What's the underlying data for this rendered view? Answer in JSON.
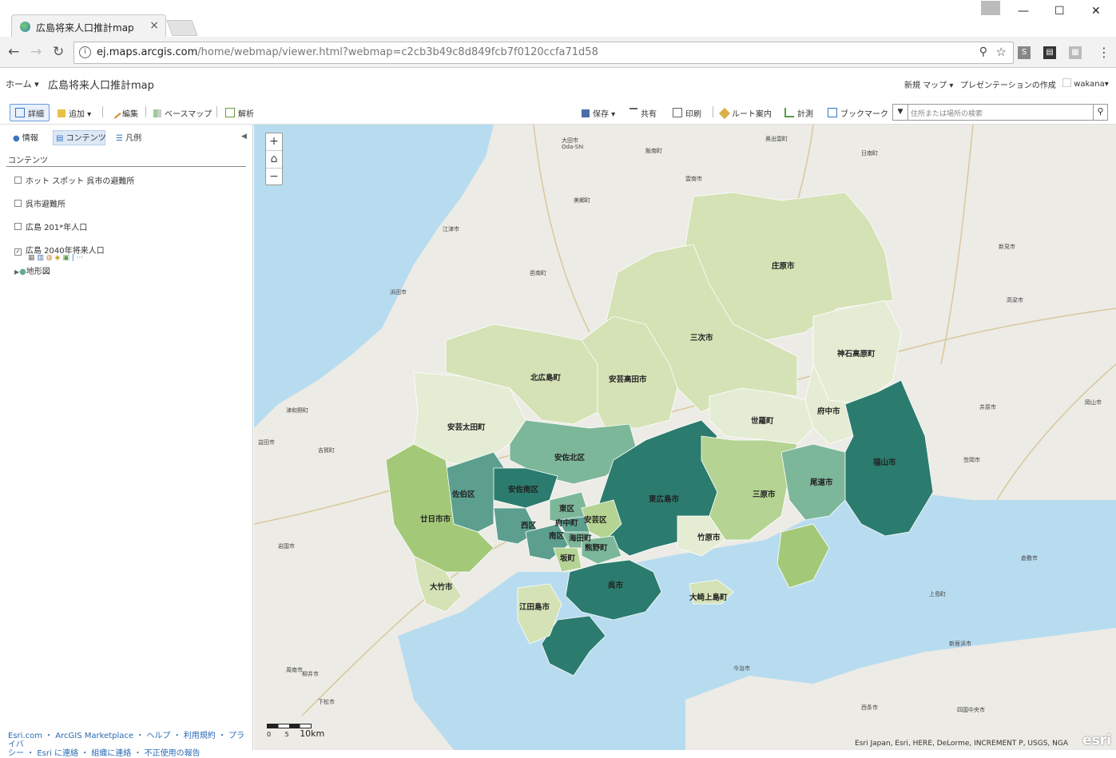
{
  "browser": {
    "tab_title": "広島将来人口推計map",
    "tab_close": "×",
    "url_main": "ej.maps.arcgis.com",
    "url_rest": "/home/webmap/viewer.html?webmap=c2cb3b49c8d849fcb7f0120ccfa71d58",
    "window_minimize": "—",
    "window_maximize": "☐",
    "window_close": "✕"
  },
  "header": {
    "home_label": "ホーム",
    "map_title": "広島将来人口推計map",
    "new_map": "新規 マップ",
    "presentation": "プレゼンテーションの作成",
    "user": "wakana"
  },
  "toolbar": {
    "details": "詳細",
    "add": "追加",
    "edit": "編集",
    "basemap": "ベースマップ",
    "analysis": "解析",
    "save": "保存",
    "share": "共有",
    "print": "印刷",
    "directions": "ルート案内",
    "measure": "計測",
    "bookmarks": "ブックマーク",
    "search_placeholder": "住所または場所の検索"
  },
  "sidebar": {
    "tabs": [
      "情報",
      "コンテンツ",
      "凡例"
    ],
    "contents_title": "コンテンツ",
    "layers": [
      {
        "label": "ホット スポット 呉市の避難所",
        "checked": false
      },
      {
        "label": "呉市避難所",
        "checked": false
      },
      {
        "label": "広島 201*年人口",
        "checked": false
      },
      {
        "label": "広島 2040年将来人口",
        "checked": true
      }
    ],
    "basemap_layer": "地形図",
    "footer_line1": "Esri.com ・ ArcGIS Marketplace ・ ヘルプ ・ 利用規約 ・ プライバ",
    "footer_line2": "シー ・ Esri に連絡 ・ 組織に連絡 ・ 不正使用の報告"
  },
  "map": {
    "attribution": "Esri Japan, Esri, HERE, DeLorme, INCREMENT P, USGS, NGA",
    "logo": "esri",
    "scale_label": "10km",
    "scale_zero": "0",
    "scale_five": "5",
    "zoom_in": "+",
    "zoom_out": "−",
    "municipalities": {
      "shobara": "庄原市",
      "miyoshi": "三次市",
      "jinseki": "神石高原町",
      "kitahiroshima": "北広島町",
      "akitakata": "安芸高田市",
      "akiota": "安芸太田町",
      "asakita": "安佐北区",
      "sera": "世羅町",
      "fuchu_city": "府中市",
      "fukuyama": "福山市",
      "asaminami": "安佐南区",
      "saeki": "佐伯区",
      "hatsukaichi": "廿日市市",
      "higashihiroshima": "東広島市",
      "mihara": "三原市",
      "onomichi": "尾道市",
      "higashi": "東区",
      "nishi": "西区",
      "aki": "安芸区",
      "fuchu_town": "府中町",
      "minami": "南区",
      "kaita": "海田町",
      "kumano": "熊野町",
      "saka": "坂町",
      "takehara": "竹原市",
      "otake": "大竹市",
      "kure": "呉市",
      "etajima": "江田島市",
      "osakikamijima": "大崎上島町"
    },
    "places": [
      "大田市",
      "Oda-Shi",
      "邑南町",
      "美郷町",
      "江津市",
      "浜田市",
      "三次市",
      "奥出雲町",
      "日南町",
      "新見市",
      "高梁市",
      "井原市",
      "笠岡市",
      "岩国市",
      "柳井市",
      "周南市",
      "下松市",
      "飯南町",
      "雲南市",
      "上島町",
      "今治市",
      "新居浜市",
      "西条市",
      "四国中央市",
      "吉賀町",
      "津和野町",
      "益田市",
      "倉敷市",
      "岡山市"
    ],
    "colors": {
      "light1": "#d4e2b6",
      "light2": "#e5ecd4",
      "mid_light": "#b5d392",
      "mid": "#a3c978",
      "teal_light": "#7db79a",
      "teal_mid": "#5c9f8f",
      "teal_dark": "#2b7c6e",
      "teal_darkest": "#1d5f55",
      "sea": "#b8dcef"
    }
  }
}
